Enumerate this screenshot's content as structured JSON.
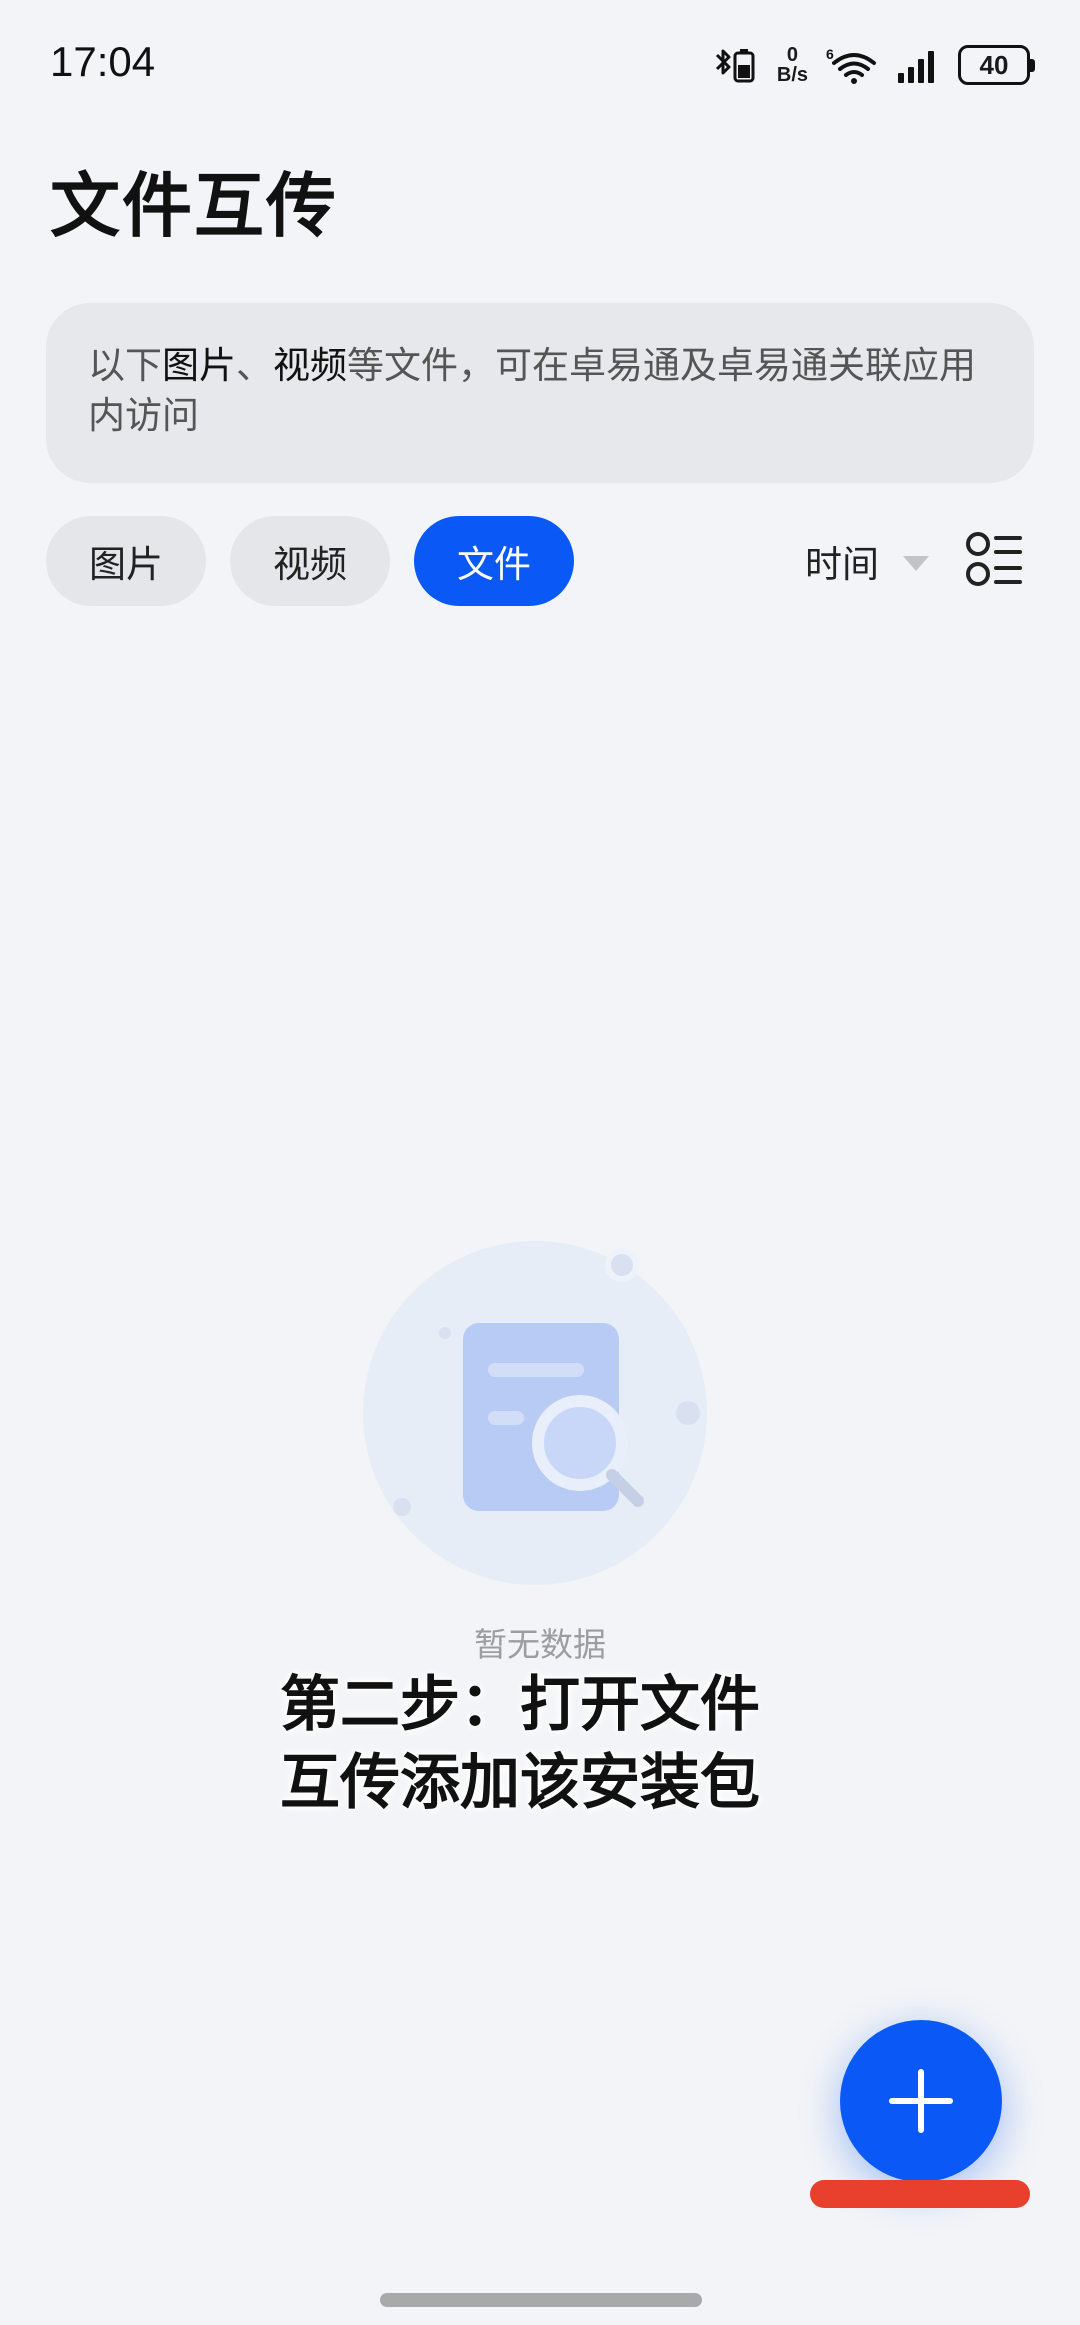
{
  "status_bar": {
    "time": "17:04",
    "net_speed_value": "0",
    "net_speed_unit": "B/s",
    "wifi_badge": "6",
    "battery_level": "40",
    "icons": [
      "bluetooth-battery-icon",
      "wifi-icon",
      "signal-icon",
      "battery-icon"
    ]
  },
  "header": {
    "title": "文件互传"
  },
  "info_banner": {
    "prefix": "以下",
    "highlight_1": "图片",
    "separator": "、",
    "highlight_2": "视频",
    "suffix": "等文件，可在卓易通及卓易通关联应用内访问"
  },
  "tabs": [
    {
      "label": "图片",
      "selected": false
    },
    {
      "label": "视频",
      "selected": false
    },
    {
      "label": "文件",
      "selected": true
    }
  ],
  "sort": {
    "label": "时间"
  },
  "empty_state": {
    "message": "暂无数据"
  },
  "overlay_caption": "第二步：打开文件互传添加该安装包",
  "colors": {
    "accent": "#0a59f7",
    "background": "#f2f4f7",
    "annotation_red": "#e8402c"
  }
}
